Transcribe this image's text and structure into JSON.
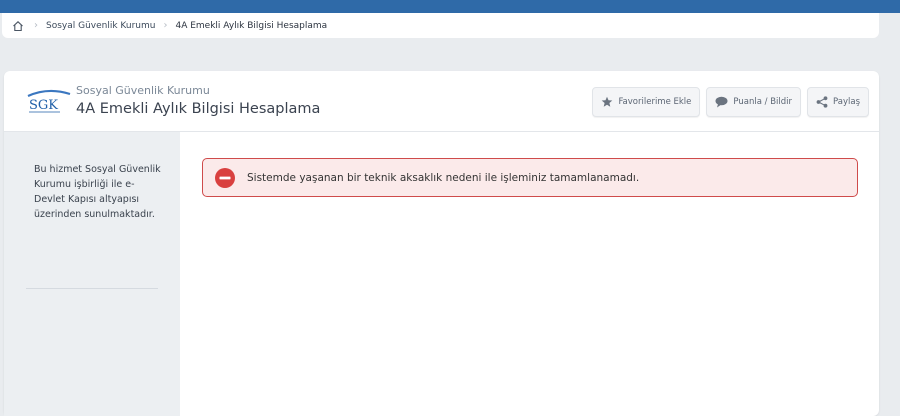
{
  "breadcrumb": {
    "home_icon": "home-icon",
    "items": [
      "Sosyal Güvenlik Kurumu",
      "4A Emekli Aylık Bilgisi Hesaplama"
    ]
  },
  "header": {
    "logo_text": "SGK",
    "org_name": "Sosyal Güvenlik Kurumu",
    "service_title": "4A Emekli Aylık Bilgisi Hesaplama"
  },
  "actions": {
    "favorite": {
      "label": "Favorilerime Ekle",
      "icon": "star-icon"
    },
    "rate": {
      "label": "Puanla / Bildir",
      "icon": "speech-bubble-icon"
    },
    "share": {
      "label": "Paylaş",
      "icon": "share-icon"
    }
  },
  "sidebar": {
    "description": "Bu hizmet Sosyal Güvenlik Kurumu işbirliği ile e-Devlet Kapısı altyapısı üzerinden sunulmaktadır."
  },
  "alert": {
    "message": "Sistemde yaşanan bir teknik aksaklık nedeni ile işleminiz tamamlanamadı.",
    "icon": "error-icon"
  },
  "colors": {
    "topbar": "#2f6aa8",
    "alert_border": "#cf4b4b",
    "alert_bg": "#fbeaea",
    "error_icon": "#d9403f"
  }
}
